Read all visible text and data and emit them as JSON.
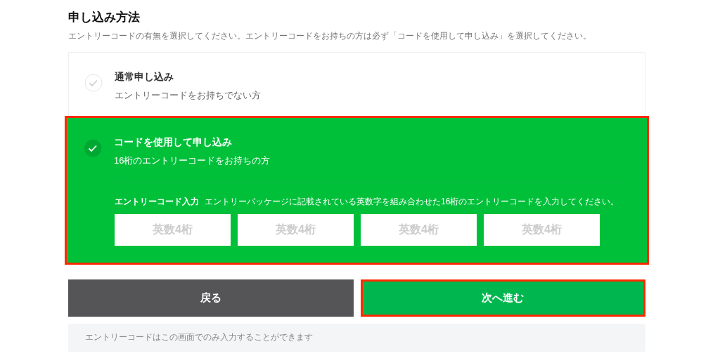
{
  "title": "申し込み方法",
  "description": "エントリーコードの有無を選択してください。エントリーコードをお持ちの方は必ず「コードを使用して申し込み」を選択してください。",
  "options": [
    {
      "title": "通常申し込み",
      "subtitle": "エントリーコードをお持ちでない方",
      "selected": false,
      "highlighted": false
    },
    {
      "title": "コードを使用して申し込み",
      "subtitle": "16桁のエントリーコードをお持ちの方",
      "selected": true,
      "highlighted": true,
      "code_label": "エントリーコード入力",
      "code_hint": "エントリーパッケージに記載されている英数字を組み合わせた16桁のエントリーコードを入力してください。",
      "fields": [
        {
          "placeholder": "英数4桁"
        },
        {
          "placeholder": "英数4桁"
        },
        {
          "placeholder": "英数4桁"
        },
        {
          "placeholder": "英数4桁"
        }
      ]
    }
  ],
  "buttons": [
    {
      "label": "戻る",
      "kind": "back",
      "highlighted": false
    },
    {
      "label": "次へ進む",
      "kind": "next",
      "highlighted": true
    }
  ],
  "note": "エントリーコードはこの画面でのみ入力することができます"
}
